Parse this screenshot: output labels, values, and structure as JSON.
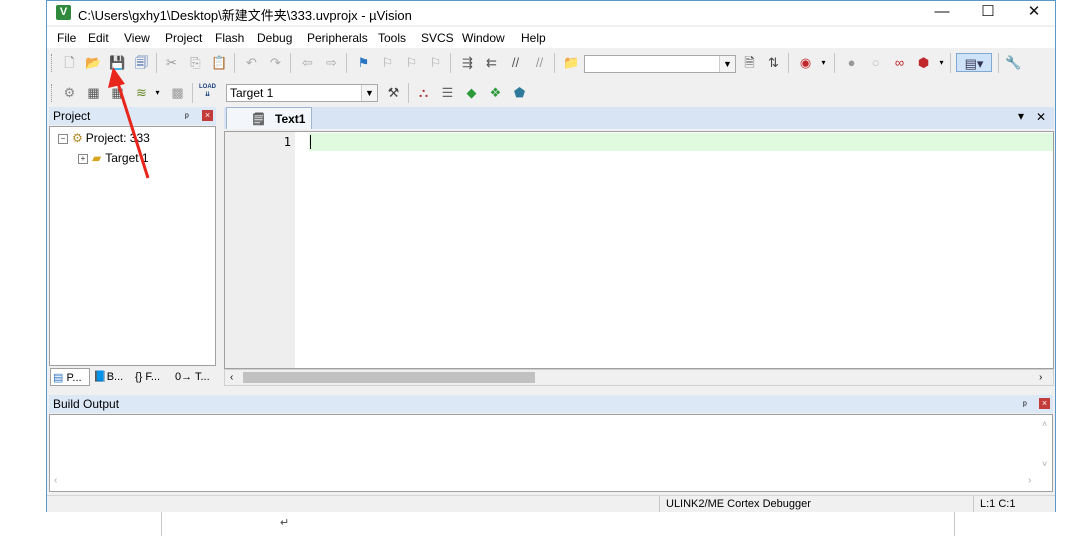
{
  "window": {
    "title": "C:\\Users\\gxhy1\\Desktop\\新建文件夹\\333.uvprojx - µVision",
    "app_icon": "V",
    "controls": {
      "minimize": "—",
      "maximize": "☐",
      "close": "✕"
    }
  },
  "menu": [
    "File",
    "Edit",
    "View",
    "Project",
    "Flash",
    "Debug",
    "Peripherals",
    "Tools",
    "SVCS",
    "Window",
    "Help"
  ],
  "toolbar2": {
    "target_select": "Target 1",
    "load_label": "LOAD"
  },
  "project_panel": {
    "title": "Project",
    "pin": "ᵖ",
    "close": "×",
    "tree": {
      "root": "Project: 333",
      "child": "Target 1"
    },
    "tabs": [
      "P...",
      "B...",
      "{} F...",
      "0→ T..."
    ]
  },
  "editor": {
    "tab": "Text1",
    "line_numbers": [
      "1"
    ],
    "dropdown_arrow": "▾",
    "close": "✕"
  },
  "build_output": {
    "title": "Build Output",
    "pin": "ᵖ",
    "close": "×"
  },
  "status": {
    "debugger": "ULINK2/ME Cortex Debugger",
    "position": "L:1 C:1"
  },
  "background_doc": {
    "return_mark": "↵"
  },
  "colors": {
    "accent_border": "#5b97c9",
    "panel_header": "#dde8f6",
    "current_line": "#e0fae0",
    "annotation_arrow": "#e8261c"
  }
}
